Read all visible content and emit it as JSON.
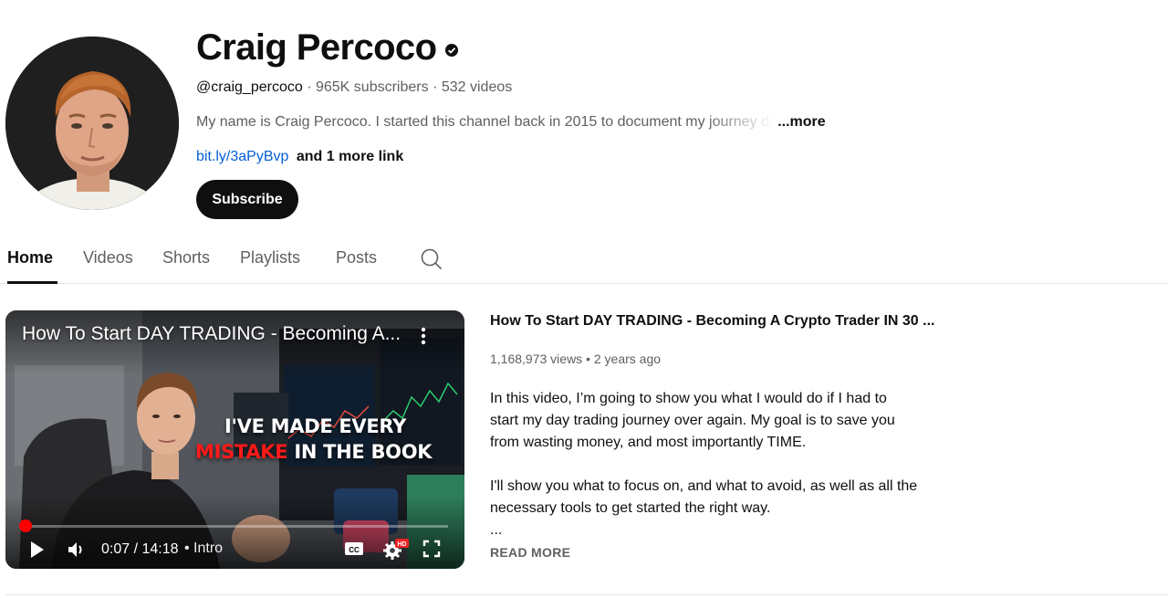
{
  "channel": {
    "name": "Craig Percoco",
    "handle": "@craig_percoco",
    "subscribers": "965K subscribers",
    "videos_count": "532 videos",
    "separator": "·",
    "description": "My name is Craig Percoco. I started this channel back in 2015 to document my journey dr",
    "more_label": "...more",
    "link_text": "bit.ly/3aPyBvp",
    "more_links_text": "and 1 more link",
    "subscribe_label": "Subscribe"
  },
  "tabs": [
    {
      "label": "Home",
      "active": true
    },
    {
      "label": "Videos",
      "active": false
    },
    {
      "label": "Shorts",
      "active": false
    },
    {
      "label": "Playlists",
      "active": false
    },
    {
      "label": "Posts",
      "active": false
    }
  ],
  "icons": {
    "verified": "verified-check-icon",
    "search": "search-icon",
    "play": "play-icon",
    "volume": "volume-icon",
    "captions": "captions-icon",
    "settings": "settings-gear-icon",
    "fullscreen": "fullscreen-icon",
    "menu": "more-vert-icon"
  },
  "featured": {
    "player_title": "How To Start DAY TRADING - Becoming A...",
    "overlay_line1": "I'VE MADE EVERY",
    "overlay_line2_red": "MISTAKE",
    "overlay_line2_rest": " IN THE BOOK",
    "current_time": "0:07",
    "duration": "14:18",
    "time_display": "0:07 / 14:18",
    "chapter": "• Intro",
    "hd_badge": "HD",
    "progress_fraction": 0.008,
    "title": "How To Start DAY TRADING - Becoming A Crypto Trader IN 30 ...",
    "views": "1,168,973 views",
    "age": "2 years ago",
    "stats_separator": "•",
    "description_p1": "In this video, I’m going to show you what I would do if I had to start my day trading journey over again. My goal is to save you from wasting money, and most importantly TIME.",
    "description_p2": "I'll show you what to focus on, and what to avoid, as well as all the necessary tools to get started the right way.",
    "ellipsis": "...",
    "read_more_label": "READ MORE"
  },
  "colors": {
    "text_primary": "#0f0f0f",
    "text_secondary": "#606060",
    "link": "#065fd4",
    "accent_red": "#ff0000",
    "subscribe_bg": "#0f0f0f"
  }
}
